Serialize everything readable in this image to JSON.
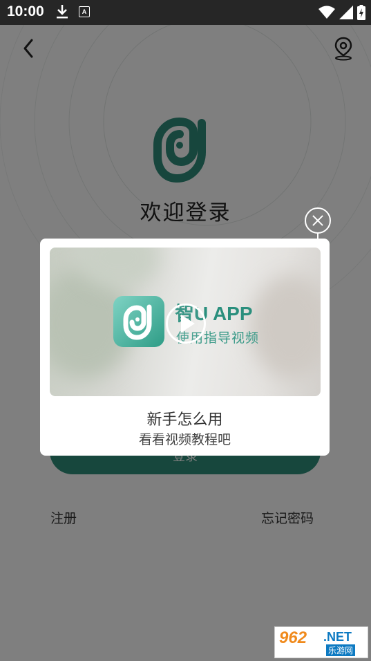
{
  "status_bar": {
    "time": "10:00"
  },
  "icons": {
    "back": "chevron-left-icon",
    "location": "location-pin-icon",
    "close": "close-icon",
    "play": "play-icon",
    "download": "download-icon",
    "wifi": "wifi-icon",
    "signal": "signal-icon",
    "battery": "battery-icon"
  },
  "login": {
    "title": "欢迎登录",
    "login_button": "登录",
    "register_link": "注册",
    "forgot_link": "忘记密码"
  },
  "popup": {
    "video_title": "智U APP",
    "video_subtitle": "使用指导视频",
    "title": "新手怎么用",
    "subtitle": "看看视频教程吧"
  },
  "watermark": {
    "main": "962",
    "net": ".NET",
    "sub": "乐游网"
  },
  "colors": {
    "brand_teal": "#2f8f7a",
    "overlay": "rgba(0,0,0,0.5)",
    "status_bar": "#262626"
  }
}
